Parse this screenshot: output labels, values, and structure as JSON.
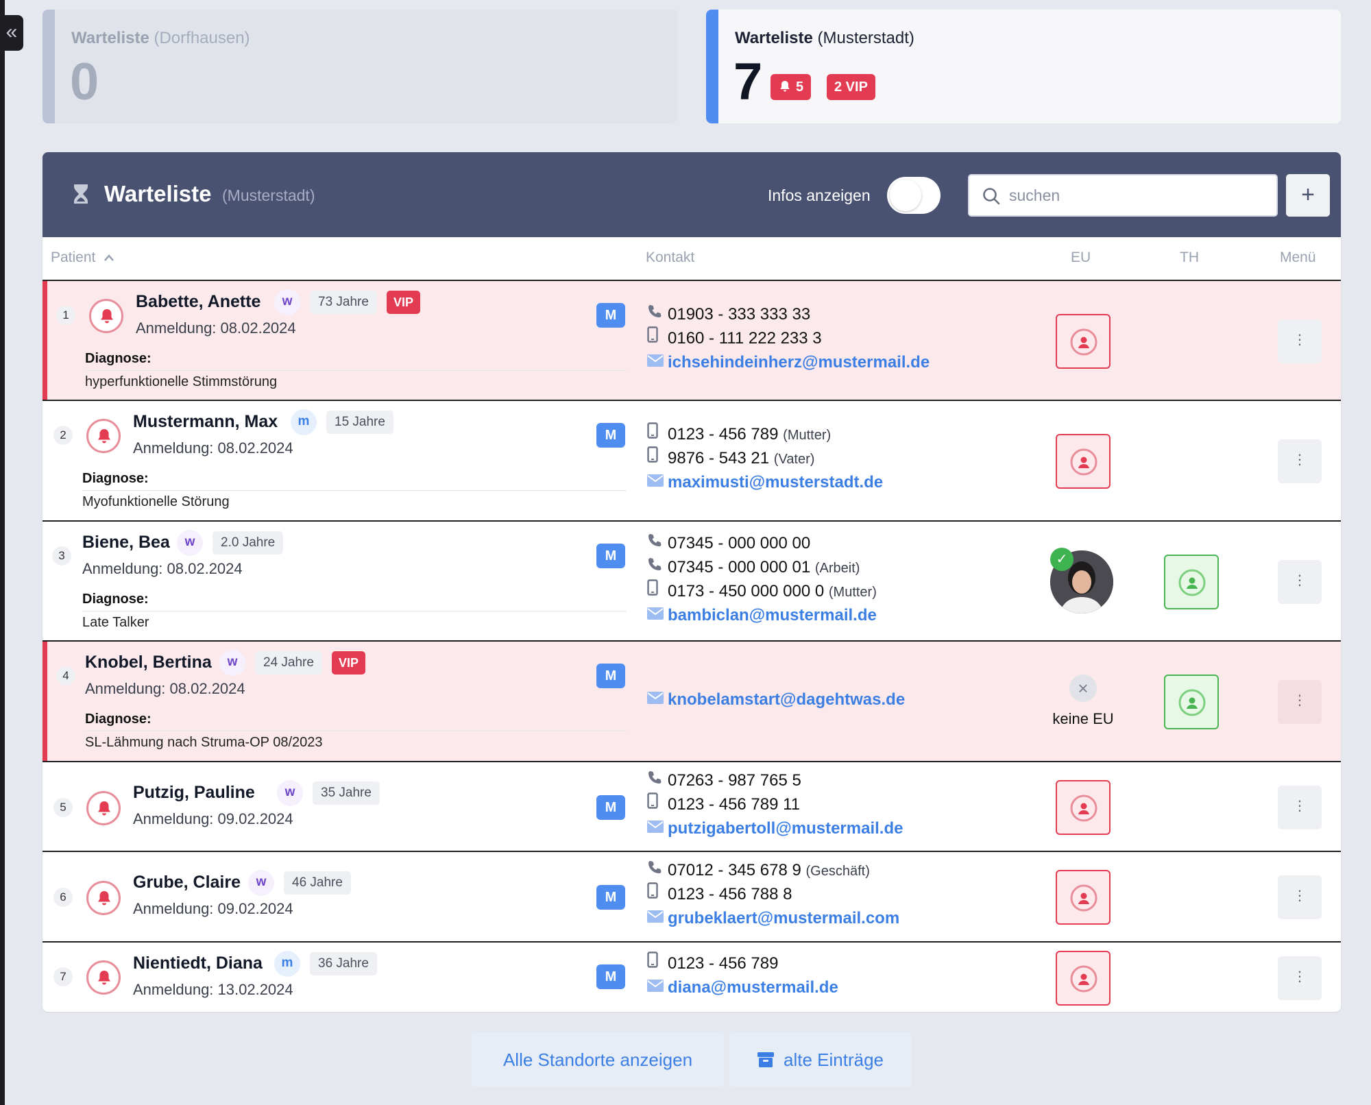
{
  "collapse_icon": "double-chevron-left-icon",
  "locations": [
    {
      "label": "Warteliste",
      "place": "(Dorfhausen)",
      "count": "0"
    },
    {
      "label": "Warteliste",
      "place": "(Musterstadt)",
      "count": "7",
      "bell_count": "5",
      "vip_count": "2 VIP"
    }
  ],
  "panel": {
    "title": "Warteliste",
    "subtitle": "(Musterstadt)",
    "infos_label": "Infos anzeigen",
    "search_placeholder": "suchen",
    "add_label": "+"
  },
  "columns": {
    "patient": "Patient",
    "kontakt": "Kontakt",
    "eu": "EU",
    "th": "TH",
    "menu": "Menü"
  },
  "rows": [
    {
      "num": "1",
      "name": "Babette, Anette",
      "gender": "w",
      "age": "73 Jahre",
      "vip": "VIP",
      "registration": "Anmeldung: 08.02.2024",
      "diagnosis_label": "Diagnose:",
      "diagnosis": "hyperfunktionelle Stimmstörung",
      "badge": "M",
      "contacts": [
        {
          "type": "phone",
          "value": "01903 - 333 333 33",
          "note": ""
        },
        {
          "type": "mobile",
          "value": "0160 - 111 222 233 3",
          "note": ""
        },
        {
          "type": "email",
          "value": "ichsehindeinherz@mustermail.de",
          "note": ""
        }
      ],
      "eu": "red",
      "th": "",
      "menu": "⋮"
    },
    {
      "num": "2",
      "name": "Mustermann, Max",
      "gender": "m",
      "age": "15 Jahre",
      "vip": "",
      "registration": "Anmeldung: 08.02.2024",
      "diagnosis_label": "Diagnose:",
      "diagnosis": "Myofunktionelle Störung",
      "badge": "M",
      "contacts": [
        {
          "type": "mobile",
          "value": "0123 - 456 789",
          "note": "(Mutter)"
        },
        {
          "type": "mobile",
          "value": "9876 - 543 21",
          "note": "(Vater)"
        },
        {
          "type": "email",
          "value": "maximusti@musterstadt.de",
          "note": ""
        }
      ],
      "eu": "red",
      "th": "",
      "menu": "⋮"
    },
    {
      "num": "3",
      "name": "Biene, Bea",
      "gender": "w",
      "age": "2.0 Jahre",
      "vip": "",
      "registration": "Anmeldung: 08.02.2024",
      "diagnosis_label": "Diagnose:",
      "diagnosis": "Late Talker",
      "badge": "M",
      "contacts": [
        {
          "type": "phone",
          "value": "07345 - 000 000 00",
          "note": ""
        },
        {
          "type": "phone",
          "value": "07345 - 000 000 01",
          "note": "(Arbeit)"
        },
        {
          "type": "mobile",
          "value": "0173 - 450 000 000 0",
          "note": "(Mutter)"
        },
        {
          "type": "email",
          "value": "bambiclan@mustermail.de",
          "note": ""
        }
      ],
      "eu": "avatar",
      "th": "green",
      "menu": "⋮"
    },
    {
      "num": "4",
      "name": "Knobel, Bertina",
      "gender": "w",
      "age": "24 Jahre",
      "vip": "VIP",
      "registration": "Anmeldung: 08.02.2024",
      "diagnosis_label": "Diagnose:",
      "diagnosis": "SL-Lähmung nach Struma-OP 08/2023",
      "badge": "M",
      "contacts": [
        {
          "type": "email",
          "value": "knobelamstart@dagehtwas.de",
          "note": ""
        }
      ],
      "eu": "none",
      "eu_text": "keine EU",
      "th": "green",
      "menu": "⋮"
    },
    {
      "num": "5",
      "name": "Putzig, Pauline",
      "gender": "w",
      "age": "35 Jahre",
      "vip": "",
      "registration": "Anmeldung: 09.02.2024",
      "badge": "M",
      "contacts": [
        {
          "type": "phone",
          "value": "07263 - 987 765 5",
          "note": ""
        },
        {
          "type": "mobile",
          "value": "0123 - 456 789 11",
          "note": ""
        },
        {
          "type": "email",
          "value": "putzigabertoll@mustermail.de",
          "note": ""
        }
      ],
      "eu": "red",
      "th": "",
      "menu": "⋮"
    },
    {
      "num": "6",
      "name": "Grube, Claire",
      "gender": "w",
      "age": "46 Jahre",
      "vip": "",
      "registration": "Anmeldung: 09.02.2024",
      "badge": "M",
      "contacts": [
        {
          "type": "phone",
          "value": "07012 - 345 678 9",
          "note": "(Geschäft)"
        },
        {
          "type": "mobile",
          "value": "0123 - 456 788 8",
          "note": ""
        },
        {
          "type": "email",
          "value": "grubeklaert@mustermail.com",
          "note": ""
        }
      ],
      "eu": "red",
      "th": "",
      "menu": "⋮"
    },
    {
      "num": "7",
      "name": "Nientiedt, Diana",
      "gender": "m",
      "age": "36 Jahre",
      "vip": "",
      "registration": "Anmeldung: 13.02.2024",
      "badge": "M",
      "contacts": [
        {
          "type": "mobile",
          "value": "0123 - 456 789",
          "note": ""
        },
        {
          "type": "email",
          "value": "diana@mustermail.de",
          "note": ""
        }
      ],
      "eu": "red",
      "th": "",
      "menu": "⋮"
    }
  ],
  "footer": {
    "all_locations": "Alle Standorte anzeigen",
    "old_entries": "alte Einträge"
  },
  "colors": {
    "accent": "#4f8ef0",
    "header": "#4a5271",
    "vip_red": "#e33b52",
    "vip_bg": "#fbe9ec",
    "green": "#49b552"
  }
}
